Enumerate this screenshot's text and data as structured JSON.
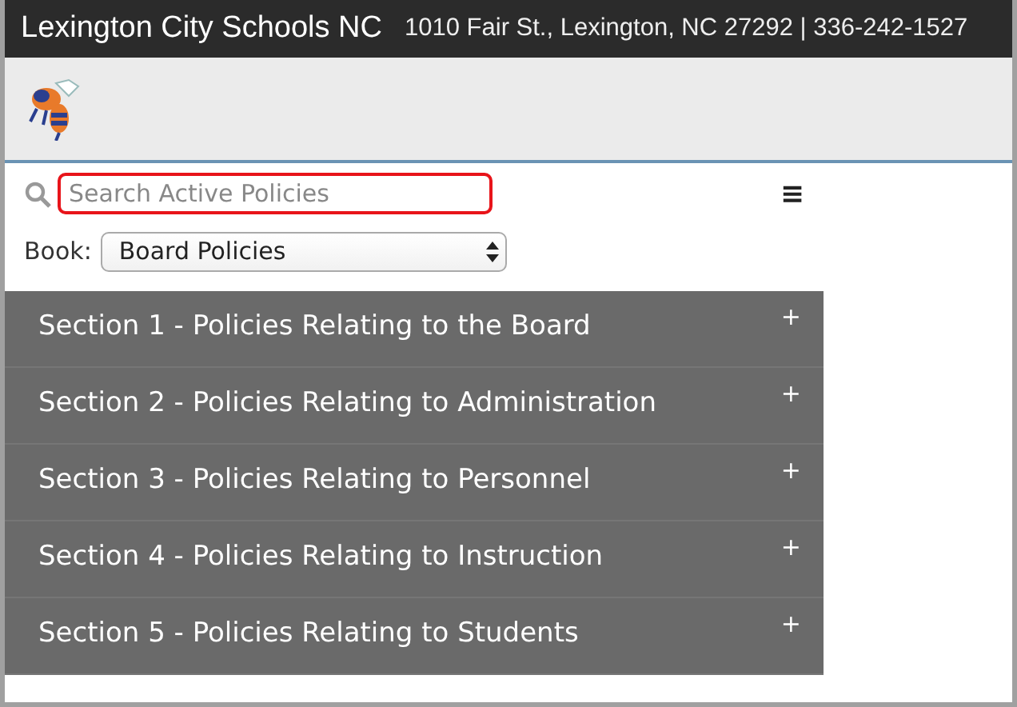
{
  "header": {
    "title": "Lexington City Schools NC",
    "address": "1010 Fair St., Lexington, NC 27292 | 336-242-1527"
  },
  "search": {
    "placeholder": "Search Active Policies",
    "highlighted": true,
    "menu_icon": "≡"
  },
  "book": {
    "label": "Book:",
    "value": "Board Policies"
  },
  "sections": [
    {
      "label": "Section 1 - Policies Relating to the Board",
      "toggle": "+"
    },
    {
      "label": "Section 2 - Policies Relating to Administration",
      "toggle": "+"
    },
    {
      "label": "Section 3 - Policies Relating to Personnel",
      "toggle": "+"
    },
    {
      "label": "Section 4 - Policies Relating to Instruction",
      "toggle": "+"
    },
    {
      "label": "Section 5 - Policies Relating to Students",
      "toggle": "+"
    }
  ]
}
